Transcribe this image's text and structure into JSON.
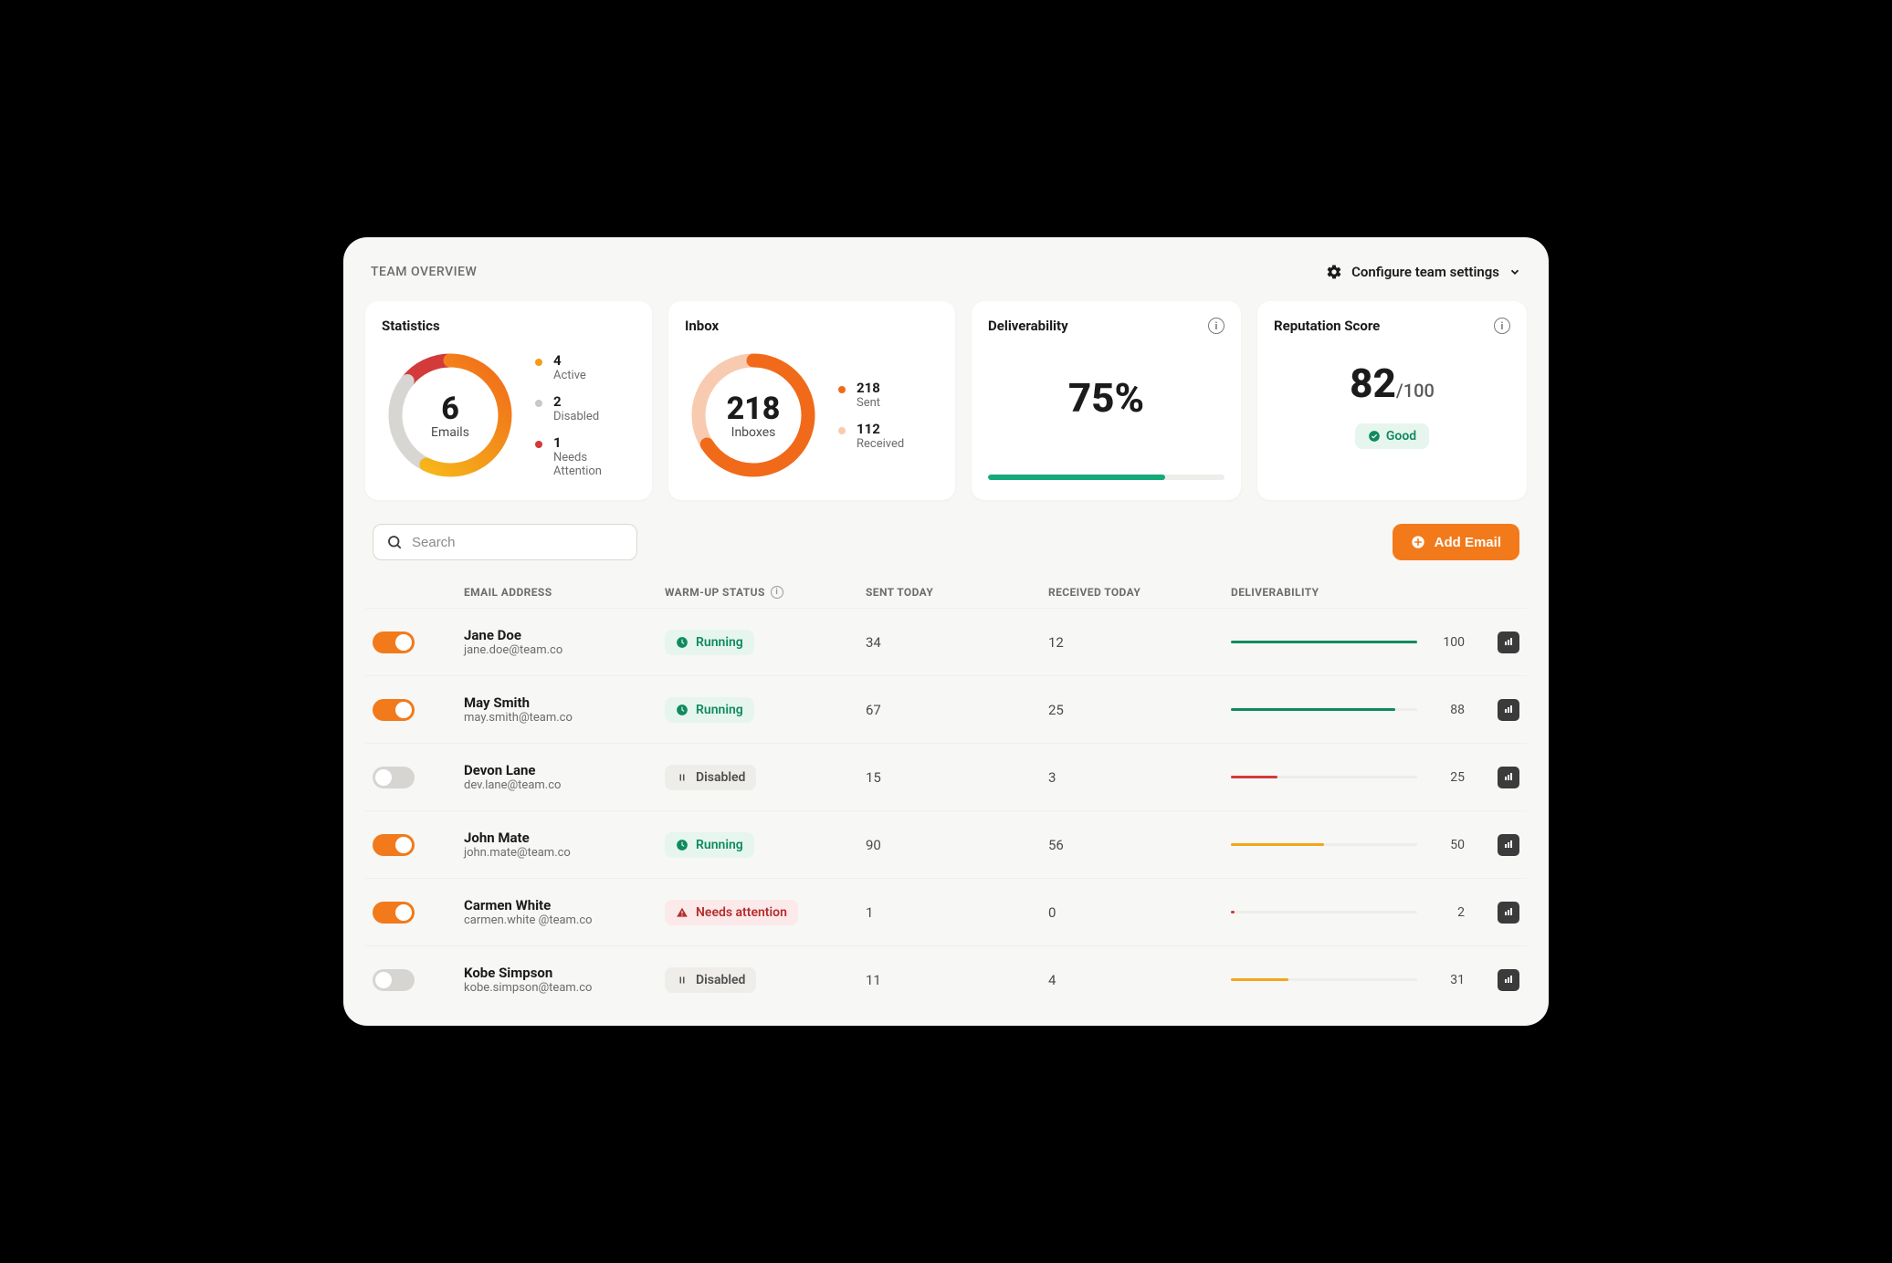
{
  "page_title": "TEAM OVERVIEW",
  "configure_label": "Configure team settings",
  "cards": {
    "statistics": {
      "title": "Statistics",
      "center_value": "6",
      "center_label": "Emails",
      "legend": [
        {
          "value": "4",
          "label": "Active",
          "color": "#f59c1a"
        },
        {
          "value": "2",
          "label": "Disabled",
          "color": "#c9c8c4"
        },
        {
          "value": "1",
          "label": "Needs Attention",
          "color": "#d33a3a"
        }
      ]
    },
    "inbox": {
      "title": "Inbox",
      "center_value": "218",
      "center_label": "Inboxes",
      "legend": [
        {
          "value": "218",
          "label": "Sent",
          "color": "#f06a1a"
        },
        {
          "value": "112",
          "label": "Received",
          "color": "#f8cab0"
        }
      ]
    },
    "deliverability": {
      "title": "Deliverability",
      "value": "75%",
      "percent": 75,
      "bar_color": "#14a97a"
    },
    "reputation": {
      "title": "Reputation Score",
      "value": "82",
      "max": "/100",
      "badge": "Good"
    }
  },
  "search_placeholder": "Search",
  "add_button_label": "Add Email",
  "columns": {
    "email": "EMAIL ADDRESS",
    "status": "WARM-UP STATUS",
    "sent": "SENT TODAY",
    "received": "RECEIVED TODAY",
    "deliv": "DELIVERABILITY"
  },
  "rows": [
    {
      "enabled": true,
      "name": "Jane Doe",
      "email": "jane.doe@team.co",
      "status": "running",
      "status_label": "Running",
      "sent": "34",
      "received": "12",
      "deliv": 100,
      "deliv_color": "#0f8a5f"
    },
    {
      "enabled": true,
      "name": "May Smith",
      "email": "may.smith@team.co",
      "status": "running",
      "status_label": "Running",
      "sent": "67",
      "received": "25",
      "deliv": 88,
      "deliv_color": "#0f8a5f"
    },
    {
      "enabled": false,
      "name": "Devon Lane",
      "email": "dev.lane@team.co",
      "status": "disabled",
      "status_label": "Disabled",
      "sent": "15",
      "received": "3",
      "deliv": 25,
      "deliv_color": "#d33a3a"
    },
    {
      "enabled": true,
      "name": "John Mate",
      "email": "john.mate@team.co",
      "status": "running",
      "status_label": "Running",
      "sent": "90",
      "received": "56",
      "deliv": 50,
      "deliv_color": "#f2a61a"
    },
    {
      "enabled": true,
      "name": "Carmen White",
      "email": "carmen.white @team.co",
      "status": "attention",
      "status_label": "Needs attention",
      "sent": "1",
      "received": "0",
      "deliv": 2,
      "deliv_color": "#d33a3a"
    },
    {
      "enabled": false,
      "name": "Kobe Simpson",
      "email": "kobe.simpson@team.co",
      "status": "disabled",
      "status_label": "Disabled",
      "sent": "11",
      "received": "4",
      "deliv": 31,
      "deliv_color": "#f2a61a"
    }
  ],
  "chart_data": [
    {
      "type": "pie",
      "title": "Statistics",
      "categories": [
        "Active",
        "Disabled",
        "Needs Attention"
      ],
      "values": [
        4,
        2,
        1
      ],
      "colors": [
        "#f59c1a",
        "#c9c8c4",
        "#d33a3a"
      ],
      "total_label": "6 Emails"
    },
    {
      "type": "pie",
      "title": "Inbox",
      "categories": [
        "Sent",
        "Received"
      ],
      "values": [
        218,
        112
      ],
      "colors": [
        "#f06a1a",
        "#f8cab0"
      ],
      "total_label": "218 Inboxes"
    },
    {
      "type": "bar",
      "title": "Deliverability",
      "categories": [
        "Deliverability"
      ],
      "values": [
        75
      ],
      "ylim": [
        0,
        100
      ],
      "ylabel": "%"
    }
  ]
}
